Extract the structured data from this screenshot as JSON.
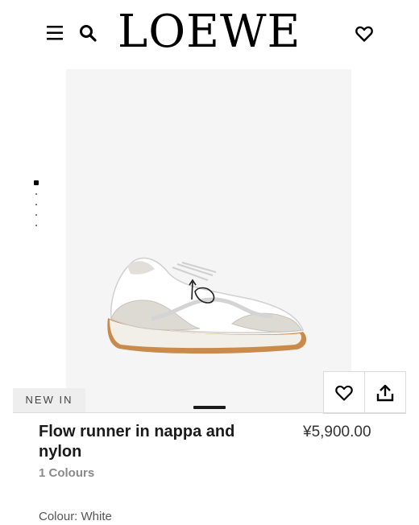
{
  "header": {
    "logo": "LOEWE",
    "icons": {
      "menu": "hamburger-menu-icon",
      "search": "search-icon",
      "wishlist": "heart-icon"
    }
  },
  "gallery": {
    "badge": "NEW IN",
    "image_count": 5,
    "active_index": 0
  },
  "product": {
    "title": "Flow runner in nappa and nylon",
    "price": "¥5,900.00",
    "colours_count": "1 Colours",
    "colour_label": "Colour: White"
  },
  "actions": {
    "favorite_icon": "heart-outline-icon",
    "share_icon": "share-upload-icon"
  },
  "colors": {
    "text": "#1a1a1a",
    "muted": "#8a8a8a",
    "sole": "#c98a4b",
    "badge_bg": "#eeeeee"
  }
}
